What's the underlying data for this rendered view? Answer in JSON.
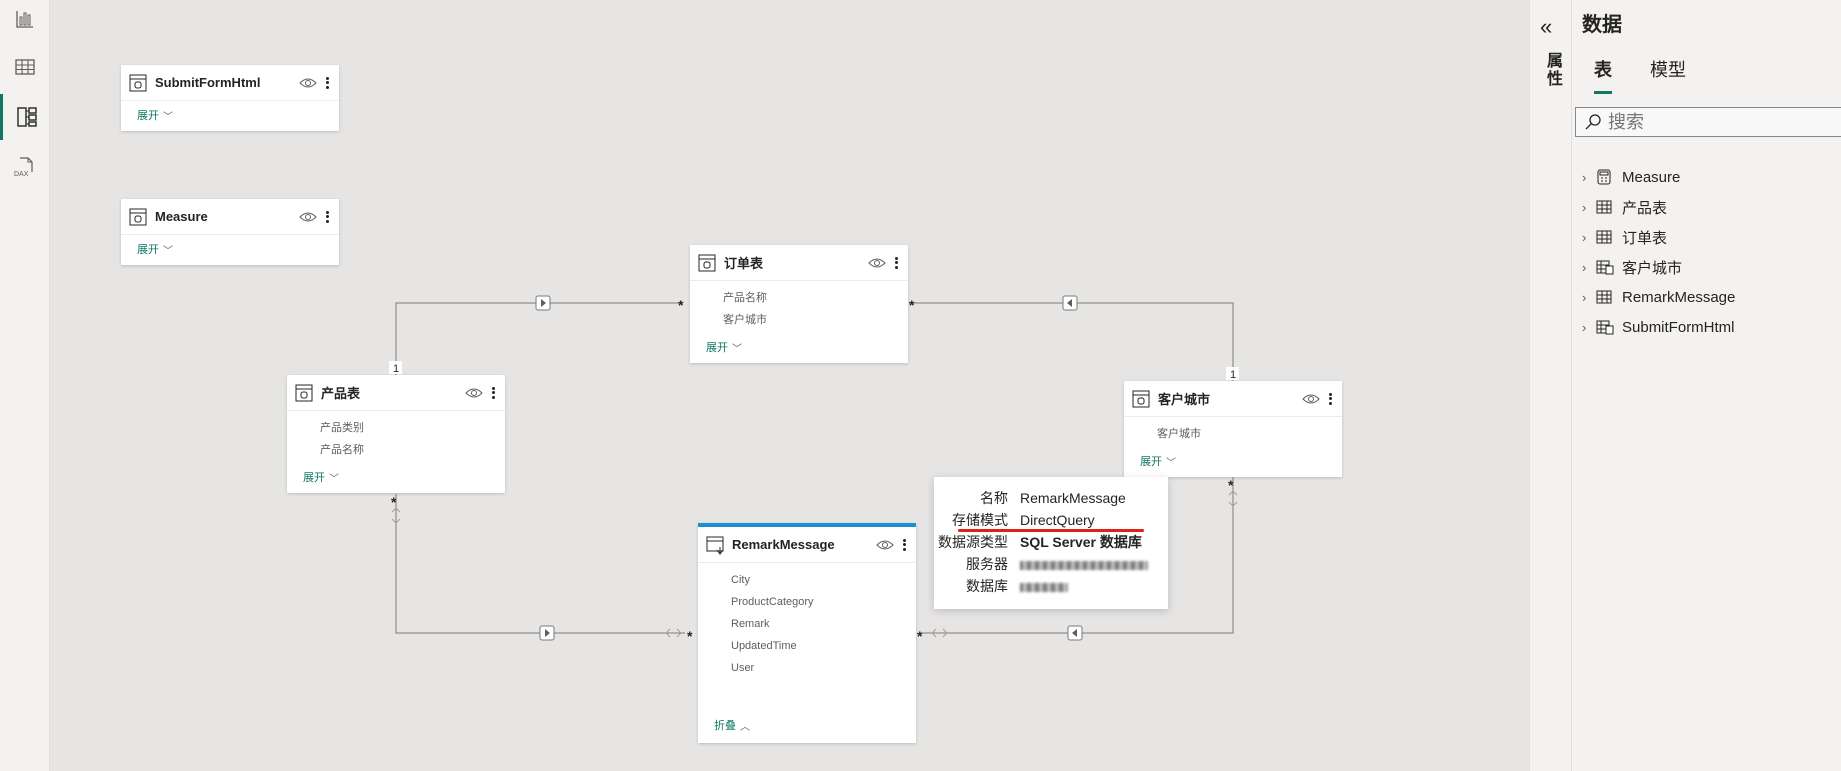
{
  "rail": {
    "items": [
      {
        "name": "report-view",
        "icon": "bar-chart-icon"
      },
      {
        "name": "table-view",
        "icon": "grid-icon"
      },
      {
        "name": "model-view",
        "icon": "model-icon",
        "active": true
      },
      {
        "name": "dax-query-view",
        "icon": "dax-icon",
        "label": "DAX"
      }
    ]
  },
  "cards": {
    "submitform": {
      "title": "SubmitFormHtml",
      "expand": "展开"
    },
    "measure": {
      "title": "Measure",
      "expand": "展开"
    },
    "orders": {
      "title": "订单表",
      "fields": [
        "产品名称",
        "客户城市"
      ],
      "expand": "展开"
    },
    "products": {
      "title": "产品表",
      "fields": [
        "产品类别",
        "产品名称"
      ],
      "expand": "展开"
    },
    "city": {
      "title": "客户城市",
      "fields": [
        "客户城市"
      ],
      "expand": "展开"
    },
    "remark": {
      "title": "RemarkMessage",
      "fields": [
        "City",
        "ProductCategory",
        "Remark",
        "UpdatedTime",
        "User"
      ],
      "collapse": "折叠"
    }
  },
  "relations": {
    "many": "*",
    "one": "1"
  },
  "tooltip": {
    "name_key": "名称",
    "name_val": "RemarkMessage",
    "storage_key": "存储模式",
    "storage_val": "DirectQuery",
    "source_key": "数据源类型",
    "source_val": "SQL Server 数据库",
    "server_key": "服务器",
    "db_key": "数据库"
  },
  "properties": {
    "collapse": "«",
    "label": "属性"
  },
  "pane": {
    "title": "数据",
    "tabs": [
      "表",
      "模型"
    ],
    "search_placeholder": "搜索",
    "items": [
      {
        "label": "Measure",
        "icon": "measure-table-icon"
      },
      {
        "label": "产品表",
        "icon": "table-icon"
      },
      {
        "label": "订单表",
        "icon": "table-icon"
      },
      {
        "label": "客户城市",
        "icon": "calculated-table-icon"
      },
      {
        "label": "RemarkMessage",
        "icon": "table-icon"
      },
      {
        "label": "SubmitFormHtml",
        "icon": "calculated-table-icon"
      }
    ]
  },
  "colors": {
    "accent": "#117865",
    "selected": "#1e8fd6",
    "highlight": "#e0201b"
  }
}
